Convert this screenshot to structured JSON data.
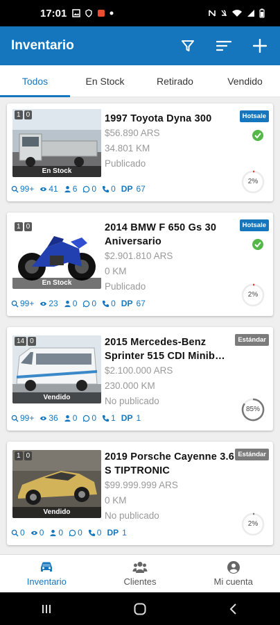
{
  "status_bar": {
    "time": "17:01"
  },
  "appbar": {
    "title": "Inventario"
  },
  "tabs": [
    {
      "label": "Todos",
      "active": true
    },
    {
      "label": "En Stock"
    },
    {
      "label": "Retirado"
    },
    {
      "label": "Vendido"
    }
  ],
  "listings": [
    {
      "photo_count": "1",
      "video_count": "0",
      "stock_label": "En Stock",
      "title": "1997 Toyota Dyna 300",
      "price": "$56.890 ARS",
      "km": "34.801 KM",
      "status": "Publicado",
      "badge": "Hotsale",
      "verified": true,
      "percent": "2%",
      "percent_value": 2,
      "stats": {
        "searches": "99+",
        "views": "41",
        "contacts": "6",
        "whatsapp": "0",
        "calls": "0",
        "dp_label": "DP",
        "dp": "67"
      }
    },
    {
      "photo_count": "1",
      "video_count": "0",
      "stock_label": "En Stock",
      "title": "2014 BMW F 650 Gs 30 Aniversario",
      "price": "$2.901.810 ARS",
      "km": "0 KM",
      "status": "Publicado",
      "badge": "Hotsale",
      "verified": true,
      "percent": "2%",
      "percent_value": 2,
      "stats": {
        "searches": "99+",
        "views": "23",
        "contacts": "0",
        "whatsapp": "0",
        "calls": "0",
        "dp_label": "DP",
        "dp": "67"
      }
    },
    {
      "photo_count": "14",
      "video_count": "0",
      "stock_label": "Vendido",
      "title": "2015 Mercedes-Benz Sprinter 515 CDI Minib…",
      "price": "$2.100.000 ARS",
      "km": "230.000 KM",
      "status": "No publicado",
      "badge": "Estándar",
      "verified": false,
      "percent": "85%",
      "percent_value": 85,
      "stats": {
        "searches": "99+",
        "views": "36",
        "contacts": "0",
        "whatsapp": "0",
        "calls": "1",
        "dp_label": "DP",
        "dp": "1"
      }
    },
    {
      "photo_count": "1",
      "video_count": "0",
      "stock_label": "Vendido",
      "title": "2019 Porsche Cayenne 3.6 S TIPTRONIC",
      "price": "$99.999.999 ARS",
      "km": "0 KM",
      "status": "No publicado",
      "badge": "Estándar",
      "verified": false,
      "percent": "2%",
      "percent_value": 2,
      "stats": {
        "searches": "0",
        "views": "0",
        "contacts": "0",
        "whatsapp": "0",
        "calls": "0",
        "dp_label": "DP",
        "dp": "1"
      }
    }
  ],
  "bottom_nav": [
    {
      "label": "Inventario",
      "icon": "car-icon",
      "active": true
    },
    {
      "label": "Clientes",
      "icon": "users-icon"
    },
    {
      "label": "Mi cuenta",
      "icon": "account-icon"
    }
  ],
  "colors": {
    "primary": "#1676bd",
    "hotsale": "#1676bd",
    "standard": "#7b7b7b",
    "verified": "#53b848",
    "gauge_low": "#e53935",
    "gauge_high": "#777777"
  }
}
